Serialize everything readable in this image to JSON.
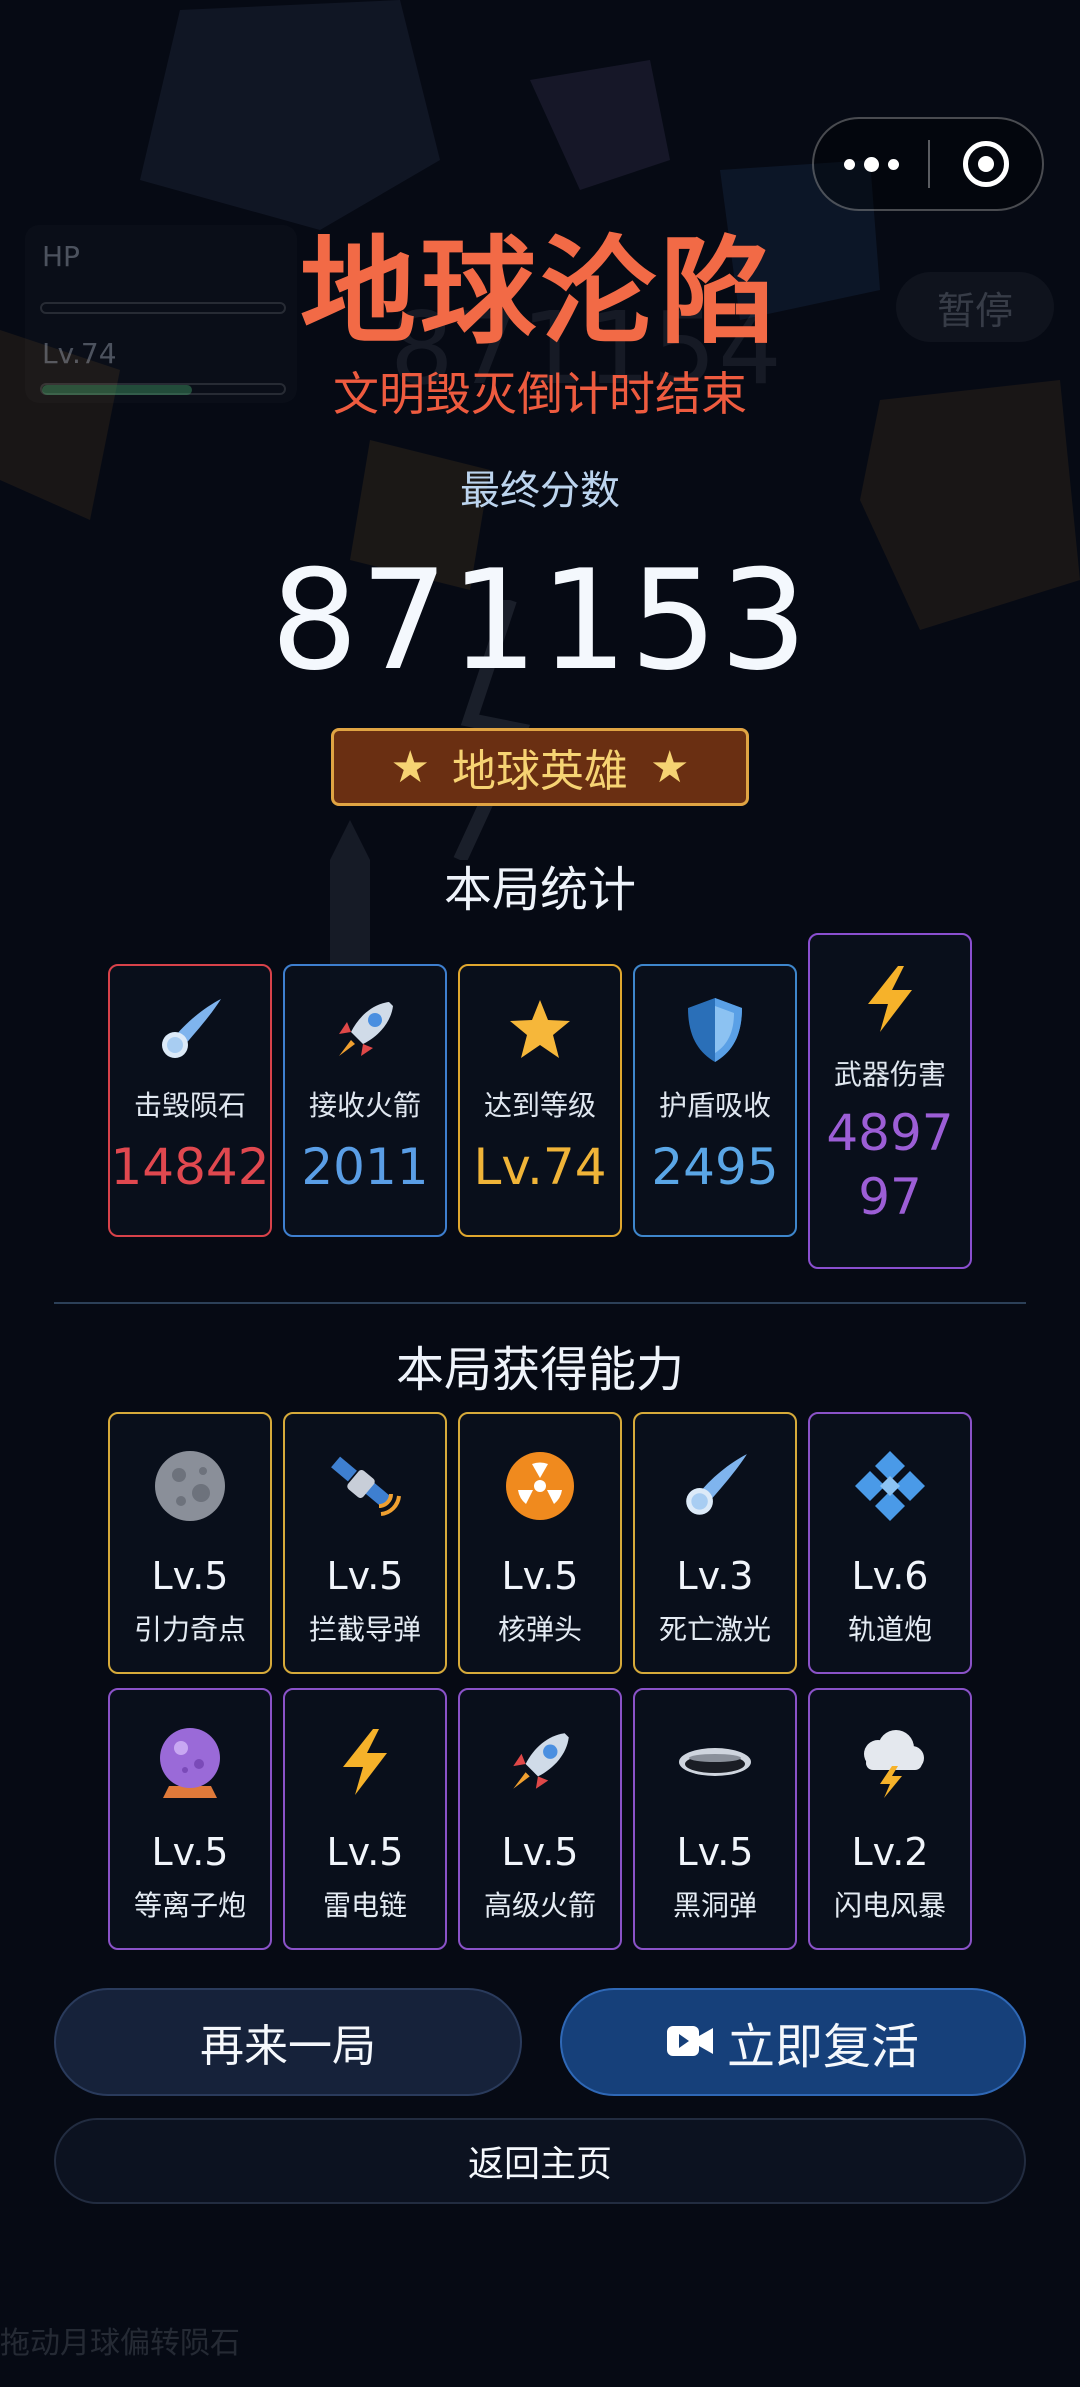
{
  "background": {
    "hud_hp_label": "HP",
    "hud_level_label": "Lv.74",
    "ghost_score": "871154",
    "pause_label": "暂停",
    "hint": "拖动月球偏转陨石"
  },
  "capsule": {
    "more_icon": "more-dots-icon",
    "close_icon": "target-icon"
  },
  "title": "地球沦陷",
  "subtitle": "文明毁灭倒计时结束",
  "score_label": "最终分数",
  "score": "871153",
  "badge": {
    "star_left": "★",
    "text": "地球英雄",
    "star_right": "★"
  },
  "stats_title": "本局统计",
  "stats": [
    {
      "icon": "comet-icon",
      "label": "击毁陨石",
      "value": "14842",
      "color": "#e0484f",
      "border": "#d8424a"
    },
    {
      "icon": "rocket-icon",
      "label": "接收火箭",
      "value": "2011",
      "color": "#5a9ee6",
      "border": "#3e7fcf"
    },
    {
      "icon": "star-icon",
      "label": "达到等级",
      "value": "Lv.74",
      "color": "#f0b438",
      "border": "#e0a72e"
    },
    {
      "icon": "shield-icon",
      "label": "护盾吸收",
      "value": "2495",
      "color": "#5aa6e6",
      "border": "#3e86cc"
    },
    {
      "icon": "lightning-icon",
      "label": "武器伤害",
      "value": "4897",
      "value2": "97",
      "color": "#9c5ed6",
      "border": "#8a4fd0"
    }
  ],
  "abilities_title": "本局获得能力",
  "abilities": [
    {
      "icon": "moon-icon",
      "level": "Lv.5",
      "name": "引力奇点",
      "border": "#d6aa3a"
    },
    {
      "icon": "satellite-icon",
      "level": "Lv.5",
      "name": "拦截导弹",
      "border": "#d6aa3a"
    },
    {
      "icon": "radiation-icon",
      "level": "Lv.5",
      "name": "核弹头",
      "border": "#d6aa3a"
    },
    {
      "icon": "comet-icon",
      "level": "Lv.3",
      "name": "死亡激光",
      "border": "#d6aa3a"
    },
    {
      "icon": "diamond-grid-icon",
      "level": "Lv.6",
      "name": "轨道炮",
      "border": "#8a52c8"
    },
    {
      "icon": "crystal-ball-icon",
      "level": "Lv.5",
      "name": "等离子炮",
      "border": "#8a52c8"
    },
    {
      "icon": "lightning-icon",
      "level": "Lv.5",
      "name": "雷电链",
      "border": "#8a52c8"
    },
    {
      "icon": "rocket-icon",
      "level": "Lv.5",
      "name": "高级火箭",
      "border": "#8a52c8"
    },
    {
      "icon": "black-hole-icon",
      "level": "Lv.5",
      "name": "黑洞弹",
      "border": "#8a52c8"
    },
    {
      "icon": "storm-cloud-icon",
      "level": "Lv.2",
      "name": "闪电风暴",
      "border": "#8a52c8"
    }
  ],
  "buttons": {
    "again": "再来一局",
    "revive": "立即复活",
    "revive_icon": "video-camera-icon",
    "home": "返回主页"
  }
}
